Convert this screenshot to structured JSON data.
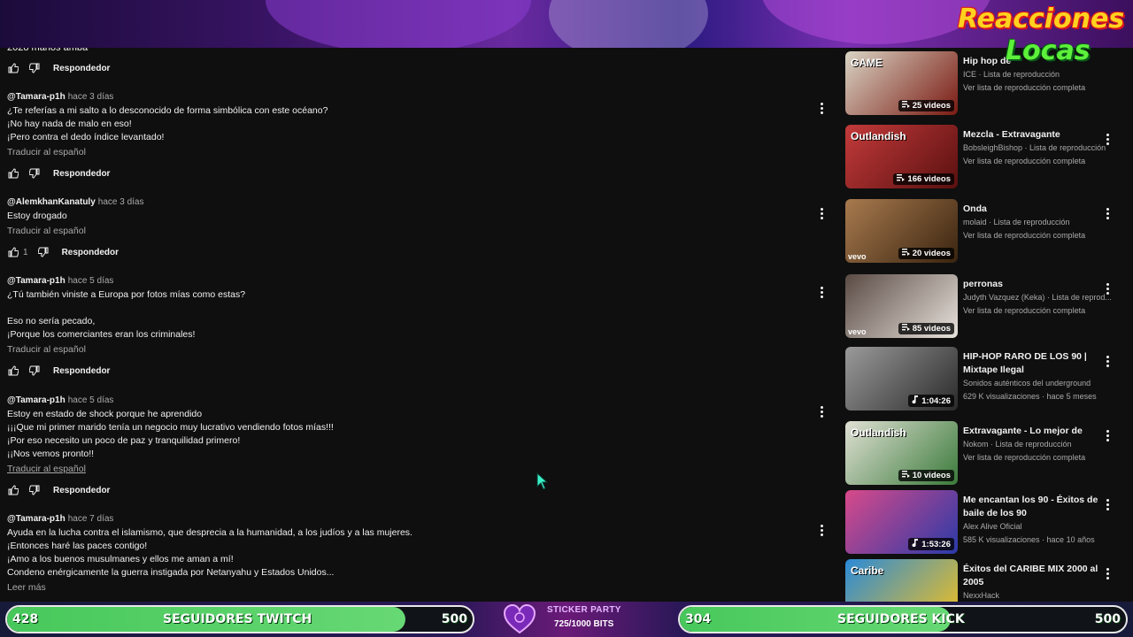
{
  "banner": {
    "logo_line1": "Reacciones",
    "logo_line2": "Locas"
  },
  "comments": {
    "partial_top_text": "2028 manos amba",
    "reply_label": "Respondedor",
    "translate_label": "Traducir al español",
    "read_more": "Leer más",
    "items": [
      {
        "author": "@Tamara-p1h",
        "time": "hace 3 días",
        "lines": [
          "¿Te referías a mi salto a lo desconocido de forma simbólica con este océano?",
          "¡No hay nada de malo en eso!",
          "¡Pero contra el dedo índice levantado!"
        ],
        "likes": ""
      },
      {
        "author": "@AlemkhanKanatuly",
        "time": "hace 3 días",
        "lines": [
          "Estoy drogado"
        ],
        "likes": "1"
      },
      {
        "author": "@Tamara-p1h",
        "time": "hace 5 días",
        "lines": [
          "¿Tú también viniste a Europa por fotos mías como estas?",
          "",
          "Eso no sería pecado,",
          "¡Porque los comerciantes eran los criminales!"
        ],
        "likes": ""
      },
      {
        "author": "@Tamara-p1h",
        "time": "hace 5 días",
        "lines": [
          "Estoy en estado de shock porque he aprendido",
          "¡¡¡Que mi primer marido tenía un negocio muy lucrativo vendiendo fotos mías!!!",
          "¡Por eso necesito un poco de paz y tranquilidad primero!",
          "¡¡Nos vemos pronto!!"
        ],
        "likes": ""
      },
      {
        "author": "@Tamara-p1h",
        "time": "hace 7 días",
        "lines": [
          "Ayuda en la lucha contra el islamismo, que desprecia a la humanidad, a los judíos y a las mujeres.",
          "¡Entonces haré las paces contigo!",
          "¡Amo a los buenos musulmanes y ellos me aman a mí!",
          "Condeno enérgicamente la guerra instigada por Netanyahu y Estados Unidos..."
        ],
        "likes": ""
      }
    ]
  },
  "sidebar": {
    "items": [
      {
        "title": "Hip hop de",
        "sub1": "ICE · Lista de reproducción",
        "sub2": "Ver lista de reproducción completa",
        "badge": "25 videos",
        "badge_type": "playlist",
        "thumb_text": "GAME",
        "colors": [
          "#d9d4c4",
          "#7a1a12"
        ]
      },
      {
        "title": "Mezcla - Extravagante",
        "sub1": "BobsleighBishop · Lista de reproducción",
        "sub2": "Ver lista de reproducción completa",
        "badge": "166 videos",
        "badge_type": "playlist",
        "thumb_text": "Outlandish",
        "colors": [
          "#c33a3a",
          "#5a1010"
        ]
      },
      {
        "title": "Onda",
        "sub1": "molaid · Lista de reproducción",
        "sub2": "Ver lista de reproducción completa",
        "badge": "20 videos",
        "badge_type": "playlist",
        "thumb_text": "vevo",
        "colors": [
          "#a87a4e",
          "#3a2410"
        ]
      },
      {
        "title": "perronas",
        "sub1": "Judyth Vazquez (Keka) · Lista de reprod...",
        "sub2": "Ver lista de reproducción completa",
        "badge": "85 videos",
        "badge_type": "playlist",
        "thumb_text": "vevo",
        "colors": [
          "#5a4a44",
          "#e8e2dc"
        ]
      },
      {
        "title": "HIP-HOP RARO DE LOS 90 | Mixtape Ilegal",
        "sub1": "Sonidos auténticos del underground",
        "sub2": "629 K visualizaciones · hace 5 meses",
        "badge": "1:04:26",
        "badge_type": "music",
        "thumb_text": "",
        "colors": [
          "#9a9a9a",
          "#2a2a2a"
        ]
      },
      {
        "title": "Extravagante - Lo mejor de",
        "sub1": "Nokom · Lista de reproducción",
        "sub2": "Ver lista de reproducción completa",
        "badge": "10 videos",
        "badge_type": "playlist",
        "thumb_text": "Outlandish",
        "colors": [
          "#e0e0d4",
          "#3a7a3a"
        ]
      },
      {
        "title": "Me encantan los 90 - Éxitos de baile de los 90",
        "sub1": "Alex Alive Oficial",
        "sub2": "585 K visualizaciones · hace 10 años",
        "badge": "1:53:26",
        "badge_type": "music",
        "thumb_text": "",
        "colors": [
          "#d84a8a",
          "#2a3aa8"
        ]
      },
      {
        "title": "Éxitos del CARIBE MIX 2000 al 2005",
        "sub1": "NexxHack",
        "sub2": "",
        "badge": "",
        "badge_type": "none",
        "thumb_text": "Caribe",
        "colors": [
          "#2a8ad8",
          "#f0c020"
        ]
      }
    ]
  },
  "bottom": {
    "twitch_current": "428",
    "twitch_label": "SEGUIDORES TWITCH",
    "twitch_goal": "500",
    "twitch_fraction": 0.856,
    "sticker_title": "STICKER PARTY",
    "sticker_progress": "725/1000 BITS",
    "kick_current": "304",
    "kick_label": "SEGUIDORES KICK",
    "kick_goal": "500",
    "kick_fraction": 0.608,
    "accent": "#4fcf62"
  }
}
